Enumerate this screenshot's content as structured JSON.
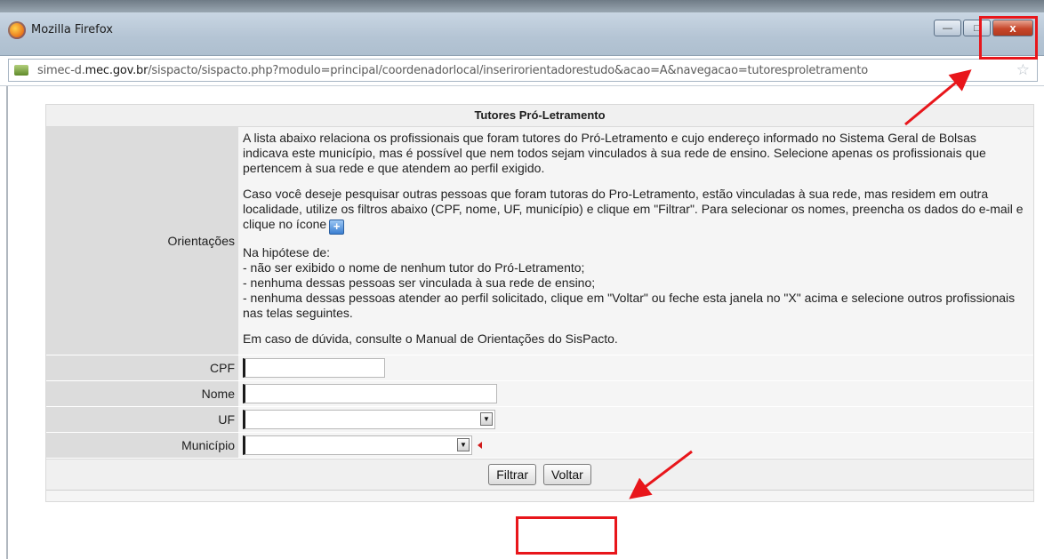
{
  "window": {
    "title": "Mozilla Firefox",
    "controls": {
      "minimize": "—",
      "maximize": "□",
      "close": "x"
    }
  },
  "urlbar": {
    "prefix": "simec-d.",
    "domain": "mec.gov.br",
    "path": "/sispacto/sispacto.php?modulo=principal/coordenadorlocal/inserirorientadorestudo&acao=A&navegacao=tutoresproletramento"
  },
  "page": {
    "title": "Tutores Pró-Letramento",
    "orientacoes": {
      "label": "Orientações",
      "p1": "A lista abaixo relaciona os profissionais que foram tutores do Pró-Letramento e cujo endereço informado no Sistema Geral de Bolsas indicava este município, mas é possível que nem todos sejam vinculados à sua rede de ensino. Selecione apenas os profissionais que pertencem à sua rede e que atendem ao perfil exigido.",
      "p2": "Caso você deseje pesquisar outras pessoas que foram tutoras do Pro-Letramento, estão vinculadas à sua rede, mas residem em outra localidade, utilize os filtros abaixo (CPF, nome, UF, município) e clique em \"Filtrar\". Para selecionar os nomes, preencha os dados do e-mail e clique no ícone",
      "p3_intro": "Na hipótese de:",
      "p3_l1": "- não ser exibido o nome de nenhum tutor do Pró-Letramento;",
      "p3_l2": "- nenhuma dessas pessoas ser vinculada à sua rede de ensino;",
      "p3_l3": "- nenhuma dessas pessoas atender ao perfil solicitado, clique em \"Voltar\" ou feche esta janela no \"X\" acima e selecione outros profissionais nas telas seguintes.",
      "p4": "Em caso de dúvida, consulte o Manual de Orientações do SisPacto."
    },
    "fields": {
      "cpf_label": "CPF",
      "cpf_value": "",
      "nome_label": "Nome",
      "nome_value": "",
      "uf_label": "UF",
      "uf_value": "",
      "municipio_label": "Município",
      "municipio_value": ""
    },
    "buttons": {
      "filtrar": "Filtrar",
      "voltar": "Voltar"
    }
  },
  "annotation_color": "#e8161b"
}
